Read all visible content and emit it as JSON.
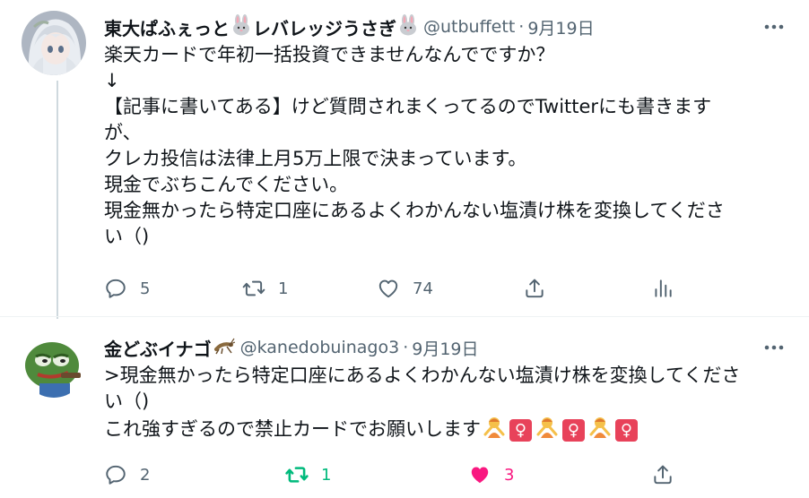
{
  "tweets": [
    {
      "display_name": "東大ぱふぇっと",
      "name_suffix": "レバレッジうさぎ",
      "handle": "@utbuffett",
      "separator": "·",
      "date": "9月19日",
      "avatar_icon": "anime-girl-avatar-icon",
      "body_lines": [
        "楽天カードで年初一括投資できませんなんでですか？",
        "↓",
        "【記事に書いてある】けど質問されまくってるのでTwitterにも書きます",
        "が、",
        "クレカ投信は法律上月5万上限で決まっています。",
        "現金でぶちこんでください。",
        "現金無かったら特定口座にあるよくわかんない塩漬け株を変換してくださ",
        "い（)"
      ],
      "reply_count": "5",
      "retweet_count": "1",
      "like_count": "74"
    },
    {
      "display_name": "金どぶイナゴ",
      "handle": "@kanedobuinago3",
      "separator": "·",
      "date": "9月19日",
      "avatar_icon": "frog-avatar-icon",
      "body_lines": [
        ">現金無かったら特定口座にあるよくわかんない塩漬け株を変換してくださ",
        "い（)",
        "これ強すぎるので禁止カードでお願いします"
      ],
      "female_sign": "♀",
      "reply_count": "2",
      "retweet_count": "1",
      "like_count": "3"
    }
  ],
  "colors": {
    "text": "#0f1419",
    "secondary": "#536471",
    "retweet_active": "#00ba7c",
    "like_active": "#f91880",
    "thread_line": "#cfd9de"
  }
}
